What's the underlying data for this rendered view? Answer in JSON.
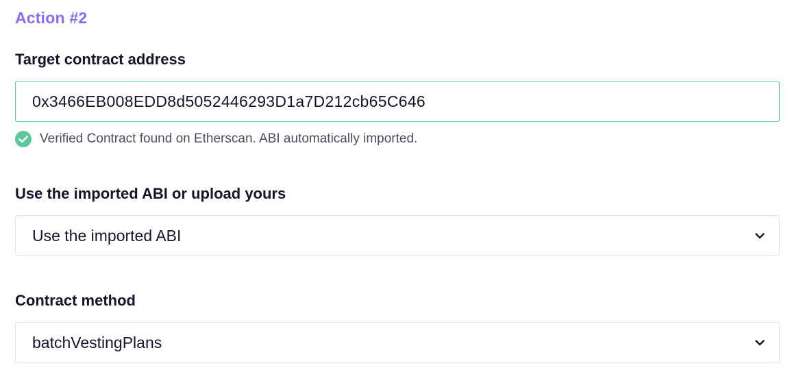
{
  "action": {
    "title": "Action #2"
  },
  "target": {
    "label": "Target contract address",
    "value": "0x3466EB008EDD8d5052446293D1a7D212cb65C646",
    "status_text": "Verified Contract found on Etherscan. ABI automatically imported.",
    "status_icon": "check-circle-icon",
    "accent_color": "#63c4a6"
  },
  "abi": {
    "label": "Use the imported ABI or upload yours",
    "selected": "Use the imported ABI"
  },
  "method": {
    "label": "Contract method",
    "selected": "batchVestingPlans"
  },
  "colors": {
    "title_accent": "#8b6cf0",
    "text_primary": "#14142b",
    "success": "#5cc8a0"
  }
}
